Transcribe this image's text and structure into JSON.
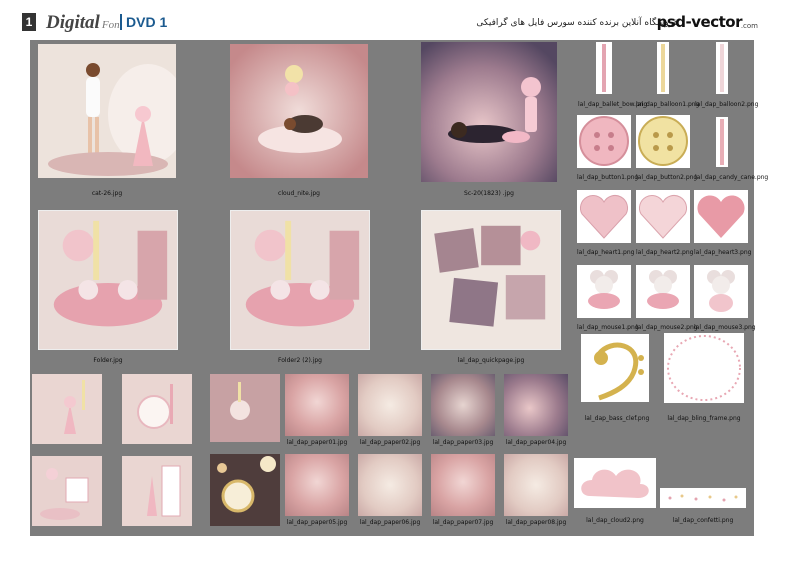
{
  "header": {
    "page_number": "1",
    "brand_main": "Digital",
    "brand_sub": "Fon",
    "dvd_label": "DVD 1",
    "store_text": "فروشگاه آنلاین برنده کننده سورس فایل های گرافیکی",
    "logo_text": "psd-vector",
    "logo_sub": ".com"
  },
  "main_grid": [
    {
      "caption": "cat-26.jpg"
    },
    {
      "caption": "cloud_nite.jpg"
    },
    {
      "caption": "Sc-20(1823) .jpg"
    },
    {
      "caption": "Folder.jpg"
    },
    {
      "caption": "Folder2 (2).jpg"
    },
    {
      "caption": "lal_dap_quickpage.jpg"
    }
  ],
  "bottom_row1": [
    {
      "caption": ""
    },
    {
      "caption": ""
    },
    {
      "caption": ""
    },
    {
      "caption": "lal_dap_paper01.jpg"
    },
    {
      "caption": "lal_dap_paper02.jpg"
    },
    {
      "caption": "lal_dap_paper03.jpg"
    },
    {
      "caption": "lal_dap_paper04.jpg"
    }
  ],
  "bottom_row2": [
    {
      "caption": ""
    },
    {
      "caption": ""
    },
    {
      "caption": ""
    },
    {
      "caption": "lal_dap_paper05.jpg"
    },
    {
      "caption": "lal_dap_paper06.jpg"
    },
    {
      "caption": "lal_dap_paper07.jpg"
    },
    {
      "caption": "lal_dap_paper08.jpg"
    }
  ],
  "right_items": [
    {
      "caption": "lal_dap_ballet_bow.png"
    },
    {
      "caption": "lal_dap_balloon1.png"
    },
    {
      "caption": "lal_dap_balloon2.png"
    },
    {
      "caption": "lal_dap_button1.png"
    },
    {
      "caption": "lal_dap_button2.png"
    },
    {
      "caption": "lal_dap_candy_cane.png"
    },
    {
      "caption": "lal_dap_heart1.png"
    },
    {
      "caption": "lal_dap_heart2.png"
    },
    {
      "caption": "lal_dap_heart3.png"
    },
    {
      "caption": "lal_dap_mouse1.png"
    },
    {
      "caption": "lal_dap_mouse2.png"
    },
    {
      "caption": "lal_dap_mouse3.png"
    },
    {
      "caption": "lal_dap_bass_clef.png"
    },
    {
      "caption": "lal_dap_bling_frame.png"
    },
    {
      "caption": "lal_dap_cloud2.png"
    },
    {
      "caption": "lal_dap_confetti.png"
    }
  ]
}
